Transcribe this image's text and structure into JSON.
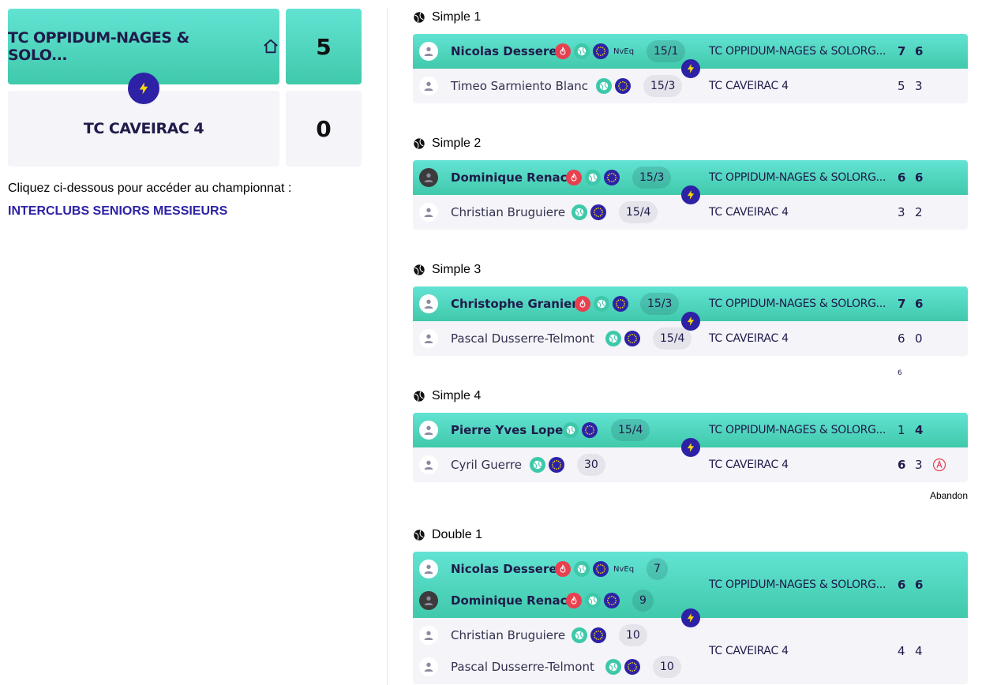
{
  "encounter": {
    "home_team": "TC OPPIDUM-NAGES & SOLO...",
    "home_score": "5",
    "away_team": "TC CAVEIRAC 4",
    "away_score": "0"
  },
  "intro_text": "Cliquez ci-dessous pour accéder au championnat :",
  "championship_link": "INTERCLUBS SENIORS MESSIEURS",
  "colors": {
    "accent": "#2d22a6",
    "winner_bg": "#4fd6bf",
    "loser_bg": "#f4f4f9",
    "fire": "#e8404f",
    "ball": "#3ec8aa"
  },
  "matches": [
    {
      "title": "Simple 1",
      "winner": {
        "name": "Nicolas Dessere",
        "tag": "NvEq",
        "rank": "15/1",
        "club": "TC OPPIDUM-NAGES & SOLORG...",
        "sets": [
          "7",
          "6"
        ]
      },
      "loser": {
        "name": "Timeo Sarmiento Blanc",
        "rank": "15/3",
        "club": "TC CAVEIRAC 4",
        "sets": [
          "5",
          "3"
        ]
      }
    },
    {
      "title": "Simple 2",
      "winner": {
        "name": "Dominique Renac",
        "rank": "15/3",
        "club": "TC OPPIDUM-NAGES & SOLORG...",
        "sets": [
          "6",
          "6"
        ]
      },
      "loser": {
        "name": "Christian Bruguiere",
        "rank": "15/4",
        "club": "TC CAVEIRAC 4",
        "sets": [
          "3",
          "2"
        ]
      }
    },
    {
      "title": "Simple 3",
      "winner": {
        "name": "Christophe Granier",
        "rank": "15/3",
        "club": "TC OPPIDUM-NAGES & SOLORG...",
        "sets": [
          "7",
          "6"
        ]
      },
      "loser": {
        "name": "Pascal Dusserre-Telmont",
        "rank": "15/4",
        "club": "TC CAVEIRAC 4",
        "sets": [
          "6",
          "0"
        ],
        "tiebreak": "6"
      }
    },
    {
      "title": "Simple 4",
      "winner": {
        "name": "Pierre Yves Lopez",
        "rank": "15/4",
        "club": "TC OPPIDUM-NAGES & SOLORG...",
        "sets": [
          "1",
          "4"
        ]
      },
      "loser": {
        "name": "Cyril Guerre",
        "rank": "30",
        "club": "TC CAVEIRAC 4",
        "sets": [
          "6",
          "3"
        ]
      },
      "note": "Abandon"
    },
    {
      "title": "Double 1",
      "winner": {
        "players": [
          {
            "name": "Nicolas Dessere",
            "tag": "NvEq",
            "rank": "7"
          },
          {
            "name": "Dominique Renac",
            "rank": "9"
          }
        ],
        "club": "TC OPPIDUM-NAGES & SOLORG...",
        "sets": [
          "6",
          "6"
        ]
      },
      "loser": {
        "players": [
          {
            "name": "Christian Bruguiere",
            "rank": "10"
          },
          {
            "name": "Pascal Dusserre-Telmont",
            "rank": "10"
          }
        ],
        "club": "TC CAVEIRAC 4",
        "sets": [
          "4",
          "4"
        ]
      }
    }
  ]
}
